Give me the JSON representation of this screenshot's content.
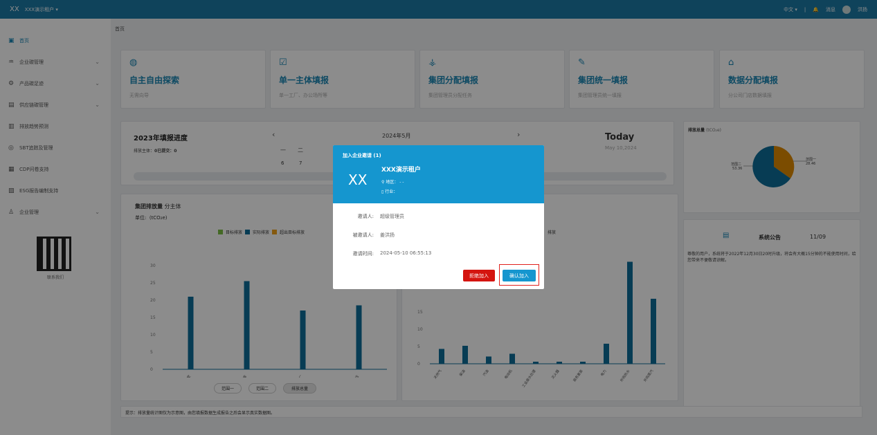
{
  "topbar": {
    "logo": "XX",
    "tenant": "XXX演示租户 ▾",
    "lang": "中文 ▾",
    "messages": "消息",
    "user": "洪扬"
  },
  "sidebar": {
    "items": [
      {
        "label": "首页",
        "icon": "▣"
      },
      {
        "label": "企业碳管理",
        "icon": "♒"
      },
      {
        "label": "产品碳足迹",
        "icon": "⚙"
      },
      {
        "label": "供应链碳管理",
        "icon": "▤"
      },
      {
        "label": "排放趋势预测",
        "icon": "▥"
      },
      {
        "label": "SBT追踪及管理",
        "icon": "◎"
      },
      {
        "label": "CDP问卷支持",
        "icon": "▦"
      },
      {
        "label": "ESG报告编制支持",
        "icon": "▧"
      },
      {
        "label": "企业管理",
        "icon": "♙"
      }
    ],
    "contact": "联系我们"
  },
  "breadcrumb": "首页",
  "cards": [
    {
      "icon": "◍",
      "title": "自主自由探索",
      "sub": "无需向导"
    },
    {
      "icon": "☑",
      "title": "单一主体填报",
      "sub": "单一工厂、办公场所等"
    },
    {
      "icon": "⚶",
      "title": "集团分配填报",
      "sub": "集团管理员分配任务"
    },
    {
      "icon": "✎",
      "title": "集团统一填报",
      "sub": "集团管理员统一填报"
    },
    {
      "icon": "⌂",
      "title": "数据分配填报",
      "sub": "分公司门店数据填报"
    }
  ],
  "progress": {
    "title": "2023年填报进度",
    "sub_label": "排放主体：",
    "sub_val": "0已提交：0",
    "month": "2024年5月",
    "prev": "‹",
    "next": "›",
    "today": "Today",
    "date": "May 10,2024",
    "wk1": "一",
    "wk2": "二",
    "d1": "6",
    "d2": "7"
  },
  "pie": {
    "title": "排放总量",
    "unit": "(tCO₂e)",
    "l1": "范围一",
    "v1": "28.46",
    "l2": "范围二",
    "v2": "53.36"
  },
  "notice": {
    "title": "系统公告",
    "date": "11/09",
    "text": "尊敬的用户，系统将于2022年12月30日20时升级，将会有大概15分钟的不能使用时间，给您带来不便敬请谅解。"
  },
  "group_chart": {
    "title": "集团排放量",
    "subtitle": "分主体",
    "unit_label": "单位:",
    "unit": "(tCO₂e)",
    "legend": [
      "目标排放",
      "实际排放",
      "超出目标排放"
    ],
    "btn1": "范围一",
    "btn2": "范围二",
    "btn3": "排放总量"
  },
  "footer_tip": "提示：排放量统计图仅为示意图，由您填报数据生成报告之后会显示真实数据图。",
  "modal": {
    "title": "加入企业邀请 (1)",
    "xx": "XX",
    "name": "XXX演示租户",
    "region": "地区：  - -",
    "industry": "行业：",
    "inviter_label": "邀请人:",
    "inviter": "超级管理员",
    "invitee_label": "被邀请人:",
    "invitee": "姜洪扬",
    "time_label": "邀请时间:",
    "time": "2024-05-10 06:55:13",
    "reject": "拒绝加入",
    "confirm": "确认加入"
  },
  "chart_data": [
    {
      "type": "bar",
      "categories": [
        "办公室",
        "仓库",
        "工厂",
        "首家门店"
      ],
      "values": [
        21,
        25.5,
        17,
        18.5
      ],
      "ylim": [
        0,
        30
      ],
      "yticks": [
        "0",
        "5",
        "10",
        "15",
        "20",
        "25",
        "30"
      ]
    },
    {
      "type": "bar",
      "categories": [
        "天然气",
        "柴油",
        "汽油",
        "电动机",
        "工业废水处理",
        "灭火器",
        "商务差旅",
        "电力",
        "外购热水",
        "外购蒸汽"
      ],
      "values": [
        4.3,
        5.2,
        2.1,
        2.9,
        0.6,
        0.6,
        0.6,
        5.8,
        29.5,
        18.8
      ],
      "ylim": [
        0,
        30
      ],
      "yticks": [
        "0",
        "5",
        "10",
        "15"
      ],
      "legend_fragment": "排放"
    }
  ],
  "colors": {
    "brand": "#1c7aa6",
    "accent": "#1596cf",
    "reject": "#d4140f",
    "bar": "#0e6e99",
    "target": "#7cbf44",
    "over": "#f0a21a",
    "pie2": "#0e6e99",
    "pie1": "#e08a00"
  }
}
